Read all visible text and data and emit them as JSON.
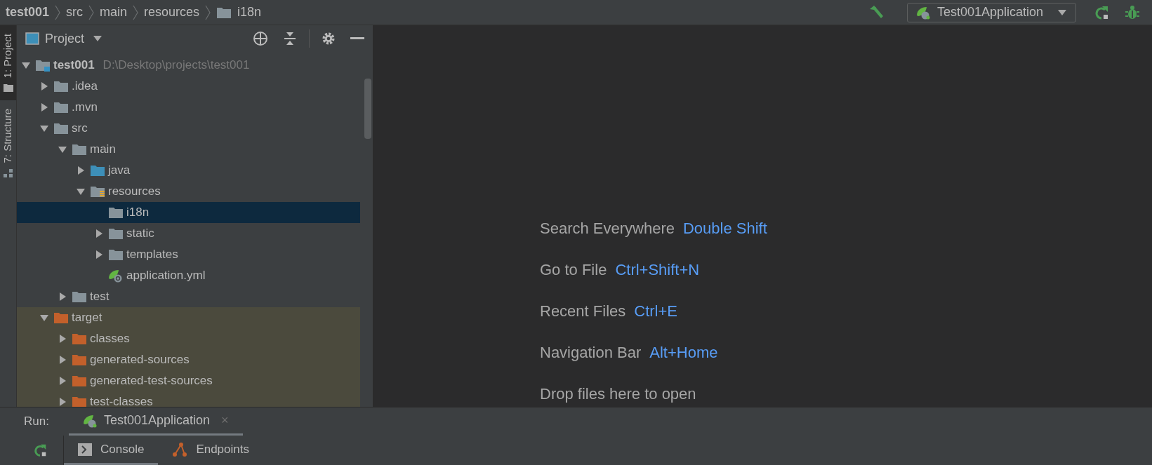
{
  "breadcrumbs": [
    {
      "label": "test001",
      "kind": "project"
    },
    {
      "label": "src",
      "kind": "text"
    },
    {
      "label": "main",
      "kind": "text"
    },
    {
      "label": "resources",
      "kind": "text"
    },
    {
      "label": "i18n",
      "kind": "folder"
    }
  ],
  "toolbar": {
    "run_config": "Test001Application"
  },
  "side_stripe": [
    {
      "label": "1: Project",
      "selected": true
    },
    {
      "label": "7: Structure",
      "selected": false
    }
  ],
  "project_panel": {
    "title": "Project",
    "tree": [
      {
        "label": "test001",
        "path": "D:\\Desktop\\projects\\test001",
        "kind": "module",
        "expanded": true,
        "selected": false,
        "children": [
          {
            "label": ".idea",
            "kind": "plain",
            "expanded": false,
            "selected": false
          },
          {
            "label": ".mvn",
            "kind": "plain",
            "expanded": false,
            "selected": false
          },
          {
            "label": "src",
            "kind": "plain",
            "expanded": true,
            "selected": false,
            "children": [
              {
                "label": "main",
                "kind": "plain",
                "expanded": true,
                "selected": false,
                "children": [
                  {
                    "label": "java",
                    "kind": "source",
                    "expanded": false,
                    "selected": false
                  },
                  {
                    "label": "resources",
                    "kind": "resources",
                    "expanded": true,
                    "selected": false,
                    "children": [
                      {
                        "label": "i18n",
                        "kind": "plain",
                        "selected": true
                      },
                      {
                        "label": "static",
                        "kind": "plain",
                        "expanded": false,
                        "selected": false
                      },
                      {
                        "label": "templates",
                        "kind": "plain",
                        "expanded": false,
                        "selected": false
                      },
                      {
                        "label": "application.yml",
                        "kind": "spring-file",
                        "selected": false
                      }
                    ]
                  }
                ]
              },
              {
                "label": "test",
                "kind": "plain",
                "expanded": false,
                "selected": false
              }
            ]
          },
          {
            "label": "target",
            "kind": "excluded",
            "expanded": true,
            "selected": false,
            "children": [
              {
                "label": "classes",
                "kind": "excluded",
                "expanded": false,
                "selected": false
              },
              {
                "label": "generated-sources",
                "kind": "excluded",
                "expanded": false,
                "selected": false
              },
              {
                "label": "generated-test-sources",
                "kind": "excluded",
                "expanded": false,
                "selected": false
              },
              {
                "label": "test-classes",
                "kind": "excluded",
                "expanded": false,
                "selected": false
              }
            ]
          }
        ]
      }
    ]
  },
  "editor_hints": [
    {
      "action": "Search Everywhere",
      "shortcut": "Double Shift"
    },
    {
      "action": "Go to File",
      "shortcut": "Ctrl+Shift+N"
    },
    {
      "action": "Recent Files",
      "shortcut": "Ctrl+E"
    },
    {
      "action": "Navigation Bar",
      "shortcut": "Alt+Home"
    },
    {
      "action": "Drop files here to open"
    }
  ],
  "run_panel": {
    "label": "Run:",
    "tabs": [
      {
        "label": "Test001Application",
        "selected": true,
        "close": "×"
      }
    ],
    "subtabs": [
      {
        "label": "Console",
        "kind": "console",
        "selected": true
      },
      {
        "label": "Endpoints",
        "kind": "endpoints",
        "selected": false
      }
    ]
  }
}
